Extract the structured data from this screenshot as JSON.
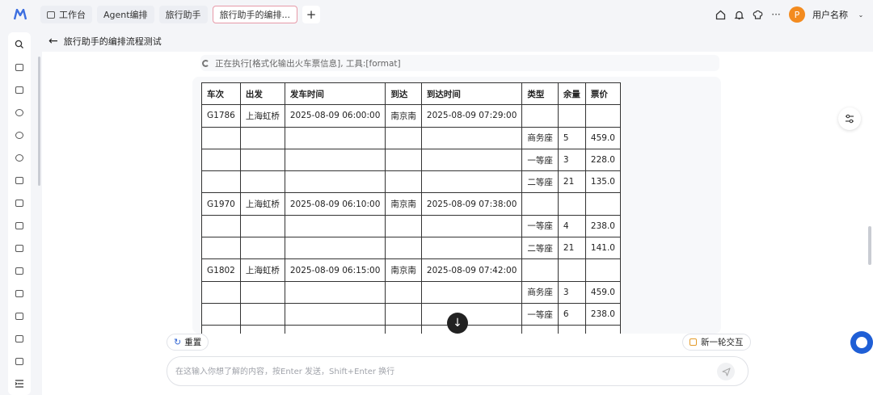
{
  "tabs": [
    {
      "label": "工作台",
      "icon": "monitor-icon",
      "active": false
    },
    {
      "label": "Agent编排",
      "active": false
    },
    {
      "label": "旅行助手",
      "active": false
    },
    {
      "label": "旅行助手的编排...",
      "active": true
    }
  ],
  "header": {
    "user_name": "用户名称",
    "avatar_letter": "P",
    "icons": [
      "home-icon",
      "bell-icon",
      "chef-hat-icon",
      "more-icon"
    ]
  },
  "page": {
    "title": "旅行助手的编排流程测试"
  },
  "status": {
    "text": "正在执行[格式化输出火车票信息], 工具:[format]"
  },
  "table": {
    "headers": [
      "车次",
      "出发",
      "发车时间",
      "到达",
      "到达时间",
      "类型",
      "余量",
      "票价"
    ],
    "rows": [
      [
        "G1786",
        "上海虹桥",
        "2025-08-09 06:00:00",
        "南京南",
        "2025-08-09 07:29:00",
        "",
        "",
        ""
      ],
      [
        "",
        "",
        "",
        "",
        "",
        "商务座",
        "5",
        "459.0"
      ],
      [
        "",
        "",
        "",
        "",
        "",
        "一等座",
        "3",
        "228.0"
      ],
      [
        "",
        "",
        "",
        "",
        "",
        "二等座",
        "21",
        "135.0"
      ],
      [
        "G1970",
        "上海虹桥",
        "2025-08-09 06:10:00",
        "南京南",
        "2025-08-09 07:38:00",
        "",
        "",
        ""
      ],
      [
        "",
        "",
        "",
        "",
        "",
        "一等座",
        "4",
        "238.0"
      ],
      [
        "",
        "",
        "",
        "",
        "",
        "二等座",
        "21",
        "141.0"
      ],
      [
        "G1802",
        "上海虹桥",
        "2025-08-09 06:15:00",
        "南京南",
        "2025-08-09 07:42:00",
        "",
        "",
        ""
      ],
      [
        "",
        "",
        "",
        "",
        "",
        "商务座",
        "3",
        "459.0"
      ],
      [
        "",
        "",
        "",
        "",
        "",
        "一等座",
        "6",
        "238.0"
      ],
      [
        "",
        "",
        "",
        "",
        "",
        "",
        "",
        ""
      ]
    ]
  },
  "actions": {
    "reset_label": "重置",
    "new_round_label": "新一轮交互"
  },
  "input": {
    "placeholder": "在这输入你想了解的内容，按Enter 发送，Shift+Enter 换行",
    "value": ""
  },
  "colors": {
    "accent_blue": "#1f5fd6",
    "avatar_orange": "#f38b1f",
    "active_tab_border": "#e79aa8"
  }
}
